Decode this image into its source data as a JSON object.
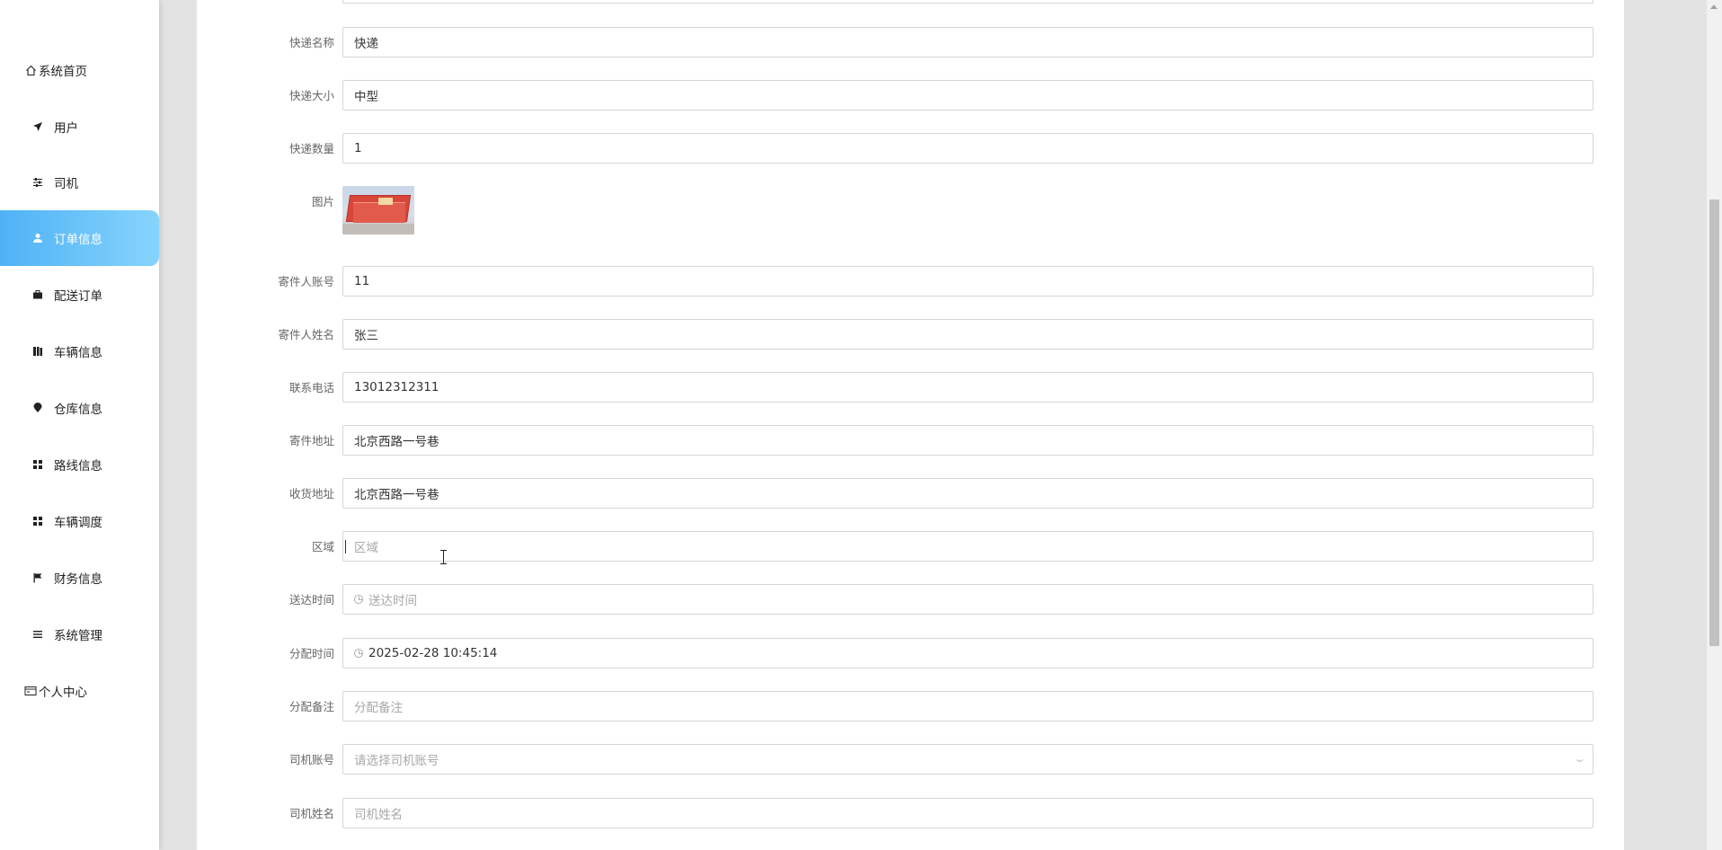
{
  "sidebar": {
    "items": [
      {
        "label": "系统首页",
        "icon": "home-icon"
      },
      {
        "label": "用户",
        "icon": "paper-plane-icon"
      },
      {
        "label": "司机",
        "icon": "sliders-icon"
      },
      {
        "label": "订单信息",
        "icon": "user-icon",
        "active": true
      },
      {
        "label": "配送订单",
        "icon": "briefcase-icon"
      },
      {
        "label": "车辆信息",
        "icon": "book-icon"
      },
      {
        "label": "仓库信息",
        "icon": "map-pin-icon"
      },
      {
        "label": "路线信息",
        "icon": "grid-icon"
      },
      {
        "label": "车辆调度",
        "icon": "grid-icon"
      },
      {
        "label": "财务信息",
        "icon": "flag-icon"
      },
      {
        "label": "系统管理",
        "icon": "list-icon"
      },
      {
        "label": "个人中心",
        "icon": "wallet-icon"
      }
    ],
    "active_color": "#4fb2f6"
  },
  "form": {
    "express_name": {
      "label": "快递名称",
      "value": "快递"
    },
    "express_size": {
      "label": "快递大小",
      "value": "中型"
    },
    "express_qty": {
      "label": "快递数量",
      "value": "1"
    },
    "image": {
      "label": "图片",
      "alt": "red parcel box photo"
    },
    "sender_account": {
      "label": "寄件人账号",
      "value": "11"
    },
    "sender_name": {
      "label": "寄件人姓名",
      "value": "张三"
    },
    "phone": {
      "label": "联系电话",
      "value": "13012312311"
    },
    "send_address": {
      "label": "寄件地址",
      "value": "北京西路一号巷"
    },
    "receive_address": {
      "label": "收货地址",
      "value": "北京西路一号巷"
    },
    "region": {
      "label": "区域",
      "placeholder": "区域"
    },
    "delivery_time": {
      "label": "送达时间",
      "placeholder": "送达时间"
    },
    "assign_time": {
      "label": "分配时间",
      "value": "2025-02-28 10:45:14"
    },
    "assign_note": {
      "label": "分配备注",
      "placeholder": "分配备注"
    },
    "driver_account": {
      "label": "司机账号",
      "placeholder": "请选择司机账号"
    },
    "driver_name": {
      "label": "司机姓名",
      "placeholder": "司机姓名"
    }
  }
}
